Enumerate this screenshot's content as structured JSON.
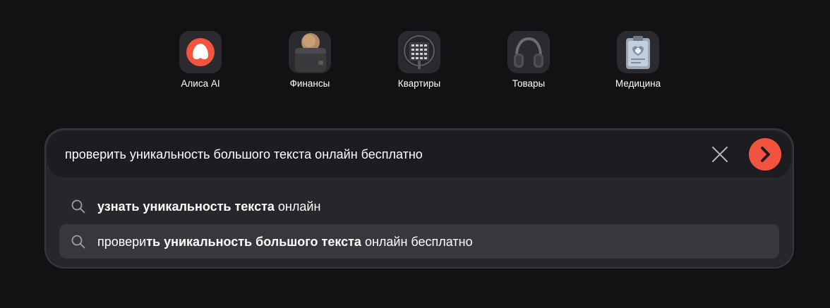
{
  "services": [
    {
      "label": "Алиса AI",
      "icon": "alice-icon",
      "color": "#f2543f"
    },
    {
      "label": "Финансы",
      "icon": "wallet-icon"
    },
    {
      "label": "Квартиры",
      "icon": "building-icon"
    },
    {
      "label": "Товары",
      "icon": "headphones-icon"
    },
    {
      "label": "Медицина",
      "icon": "medical-clipboard-icon"
    }
  ],
  "search": {
    "query": "проверить уникальность большого текста онлайн бесплатно",
    "clear_icon": "close-icon",
    "submit_icon": "chevron-right-icon",
    "submit_color": "#f2543f"
  },
  "suggestions": [
    {
      "parts": [
        {
          "text": "узнать уникальность текста",
          "bold": true
        },
        {
          "text": " онлайн",
          "bold": false
        }
      ],
      "active": false
    },
    {
      "parts": [
        {
          "text": "провери",
          "bold": false
        },
        {
          "text": "ть уникальность большого текста",
          "bold": true
        },
        {
          "text": " онлайн бесплатно",
          "bold": false
        }
      ],
      "active": true
    }
  ]
}
